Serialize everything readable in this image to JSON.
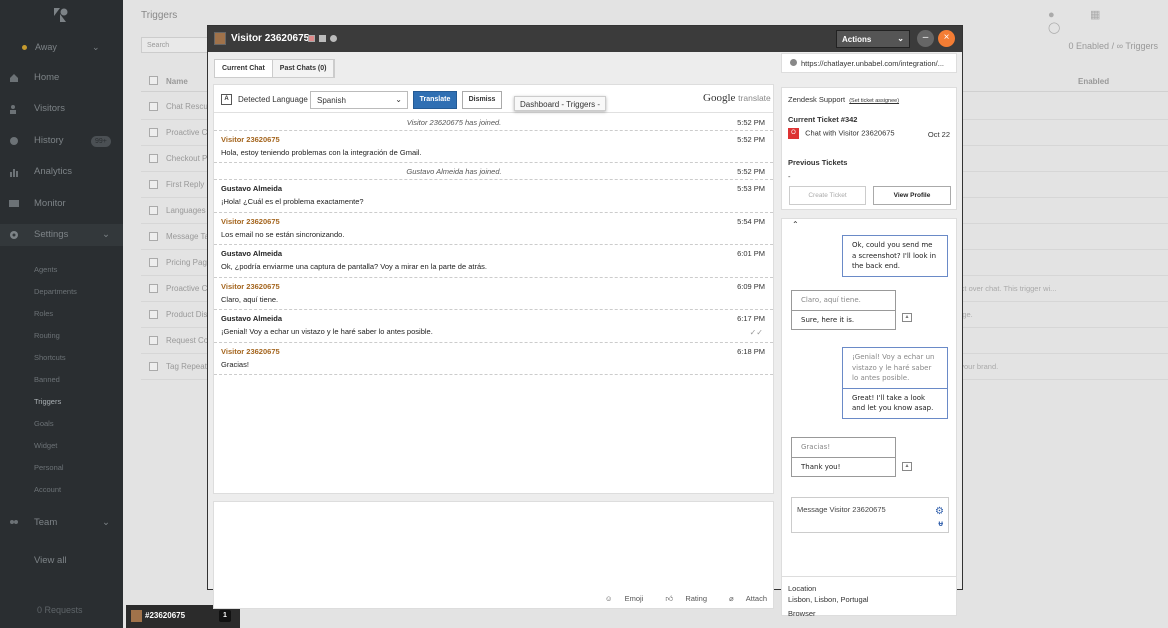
{
  "sidebar": {
    "status": "Away",
    "nav": [
      {
        "label": "Home",
        "icon": "home-icon"
      },
      {
        "label": "Visitors",
        "icon": "visitors-icon"
      },
      {
        "label": "History",
        "icon": "history-icon",
        "badge": "99+"
      },
      {
        "label": "Analytics",
        "icon": "analytics-icon"
      },
      {
        "label": "Monitor",
        "icon": "monitor-icon"
      },
      {
        "label": "Settings",
        "icon": "settings-icon"
      }
    ],
    "settings_items": [
      "Agents",
      "Departments",
      "Roles",
      "Routing",
      "Shortcuts",
      "Banned",
      "Triggers",
      "Goals",
      "Widget",
      "Personal",
      "Account"
    ],
    "team": "Team",
    "view_all": "View all",
    "requests": "0 Requests"
  },
  "main": {
    "title": "Triggers",
    "search_placeholder": "Search",
    "summary": "0 Enabled / ∞ Triggers",
    "col_name": "Name",
    "col_enabled": "Enabled",
    "rows": [
      {
        "name": "Chat Rescue",
        "desc": ""
      },
      {
        "name": "Proactive C",
        "desc": ""
      },
      {
        "name": "Checkout P",
        "desc": ""
      },
      {
        "name": "First Reply",
        "desc": ""
      },
      {
        "name": "Languages",
        "desc": ""
      },
      {
        "name": "Message Ta",
        "desc": ""
      },
      {
        "name": "Pricing Pag",
        "desc": ""
      },
      {
        "name": "Proactive C",
        "desc": "ract over chat. This trigger wi..."
      },
      {
        "name": "Product Dis",
        "desc": "page."
      },
      {
        "name": "Request Co",
        "desc": ""
      },
      {
        "name": "Tag Repeat",
        "desc": "n your brand."
      }
    ]
  },
  "chat_tab": {
    "id": "#23620675",
    "count": "1"
  },
  "window": {
    "visitor_name": "Visitor 23620675",
    "actions_label": "Actions",
    "min_label": "–",
    "close_label": "×",
    "tabs": [
      "Current Chat",
      "Past Chats (0)"
    ],
    "translate_bar": {
      "detected_label": "Detected Language",
      "language": "Spanish",
      "translate_btn": "Translate",
      "dismiss_btn": "Dismiss",
      "tooltip": "Dashboard - Triggers -",
      "google_label": "Google",
      "translate_label": "translate"
    },
    "messages": [
      {
        "type": "system",
        "text": "Visitor 23620675 has joined.",
        "time": "5:52 PM"
      },
      {
        "type": "visitor",
        "who": "Visitor 23620675",
        "text": "Hola, estoy teniendo problemas con la integración de Gmail.",
        "time": "5:52 PM"
      },
      {
        "type": "system",
        "text": "Gustavo Almeida has joined.",
        "time": "5:52 PM"
      },
      {
        "type": "agent",
        "who": "Gustavo Almeida",
        "text": "¡Hola! ¿Cuál es el problema exactamente?",
        "time": "5:53 PM"
      },
      {
        "type": "visitor",
        "who": "Visitor 23620675",
        "text": "Los email no se están sincronizando.",
        "time": "5:54 PM"
      },
      {
        "type": "agent",
        "who": "Gustavo Almeida",
        "text": "Ok, ¿podría enviarme una captura de pantalla? Voy a mirar en la parte de atrás.",
        "time": "6:01 PM"
      },
      {
        "type": "visitor",
        "who": "Visitor 23620675",
        "text": "Claro, aquí tiene.",
        "time": "6:09 PM"
      },
      {
        "type": "agent",
        "who": "Gustavo Almeida",
        "text": "¡Genial! Voy a echar un vistazo y le haré saber lo antes posible.",
        "time": "6:17 PM",
        "tick": "✓✓"
      },
      {
        "type": "visitor",
        "who": "Visitor 23620675",
        "text": "Gracias!",
        "time": "6:18 PM"
      }
    ],
    "compose_footer": {
      "emoji": "Emoji",
      "rating": "Rating",
      "attach": "Attach"
    }
  },
  "right_panel": {
    "url": "https://chatlayer.unbabel.com/integration/...",
    "zendesk": {
      "title": "Zendesk Support",
      "link": "(Set ticket assignee)",
      "current_ticket": "Current Ticket #342",
      "ticket_badge": "O",
      "ticket_title": "Chat with Visitor 23620675",
      "ticket_date": "Oct 22",
      "previous": "Previous Tickets",
      "previous_value": "-",
      "create_btn": "Create Ticket",
      "profile_btn": "View Profile"
    },
    "unbabel": {
      "collapse": "⌃",
      "b1": "Ok, could you send me a screenshot? I'll look in the back end.",
      "b2_orig": "Claro, aquí tiene.",
      "b2_tr": "Sure, here it is.",
      "b3_orig": "¡Genial! Voy a echar un vistazo y le haré saber lo antes posible.",
      "b3_tr": "Great! I'll take a look and let you know asap.",
      "b4_orig": "Gracias!",
      "b4_tr": "Thank you!",
      "placeholder": "Message Visitor 23620675"
    },
    "location_label": "Location",
    "location": "Lisbon, Lisbon, Portugal",
    "browser_label": "Browser"
  }
}
